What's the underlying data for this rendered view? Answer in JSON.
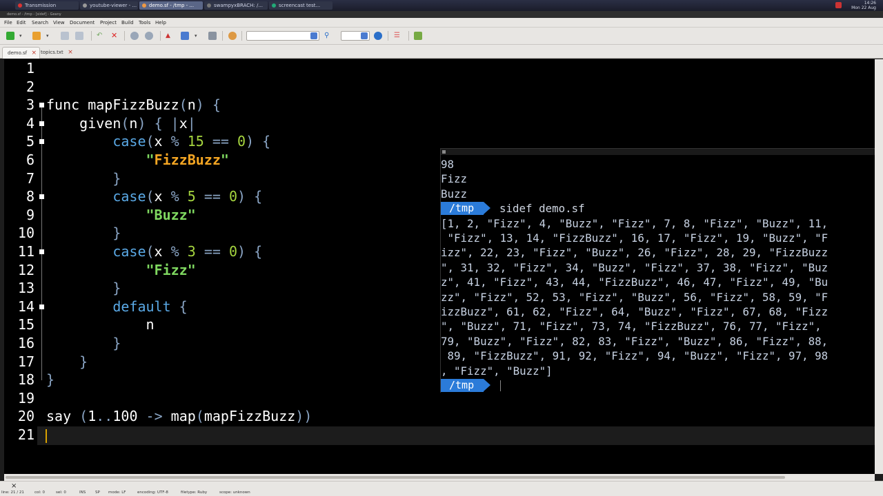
{
  "taskbar": {
    "tasks": [
      {
        "label": "Transmission",
        "color": "#d33"
      },
      {
        "label": "youtube-viewer - ...",
        "color": "#999"
      },
      {
        "label": "demo.sf - /tmp - ...",
        "color": "#e94"
      },
      {
        "label": "swampyxBRACH: /...",
        "color": "#777"
      },
      {
        "label": "screencast test...",
        "color": "#2a7"
      }
    ],
    "clock_time": "14:26",
    "clock_date": "Mon 22 Aug"
  },
  "window_title": "demo.sf - /tmp - [sidef] - Geany",
  "menu": [
    "File",
    "Edit",
    "Search",
    "View",
    "Document",
    "Project",
    "Build",
    "Tools",
    "Help"
  ],
  "tabs": [
    {
      "label": "demo.sf"
    },
    {
      "label": "topics.txt"
    }
  ],
  "editor": {
    "lines": [
      {
        "n": "1",
        "code": ""
      },
      {
        "n": "2",
        "code": ""
      },
      {
        "n": "3",
        "code": "func mapFizzBuzz(n) {"
      },
      {
        "n": "4",
        "code": "    given(n) { |x|"
      },
      {
        "n": "5",
        "code": "        case(x % 15 == 0) {"
      },
      {
        "n": "6",
        "code": "            \"FizzBuzz\""
      },
      {
        "n": "7",
        "code": "        }"
      },
      {
        "n": "8",
        "code": "        case(x % 5 == 0) {"
      },
      {
        "n": "9",
        "code": "            \"Buzz\""
      },
      {
        "n": "10",
        "code": "        }"
      },
      {
        "n": "11",
        "code": "        case(x % 3 == 0) {"
      },
      {
        "n": "12",
        "code": "            \"Fizz\""
      },
      {
        "n": "13",
        "code": "        }"
      },
      {
        "n": "14",
        "code": "        default {"
      },
      {
        "n": "15",
        "code": "            n"
      },
      {
        "n": "16",
        "code": "        }"
      },
      {
        "n": "17",
        "code": "    }"
      },
      {
        "n": "18",
        "code": "}"
      },
      {
        "n": "19",
        "code": ""
      },
      {
        "n": "20",
        "code": "say (1..100 -> map(mapFizzBuzz))"
      },
      {
        "n": "21",
        "code": ""
      }
    ]
  },
  "terminal": {
    "prev_lines": [
      "98",
      "Fizz",
      "Buzz"
    ],
    "prompt_dir": "/tmp",
    "command": "sidef demo.sf",
    "output": [
      "[1, 2, \"Fizz\", 4, \"Buzz\", \"Fizz\", 7, 8, \"Fizz\", \"Buzz\", 11,",
      " \"Fizz\", 13, 14, \"FizzBuzz\", 16, 17, \"Fizz\", 19, \"Buzz\", \"F",
      "izz\", 22, 23, \"Fizz\", \"Buzz\", 26, \"Fizz\", 28, 29, \"FizzBuzz",
      "\", 31, 32, \"Fizz\", 34, \"Buzz\", \"Fizz\", 37, 38, \"Fizz\", \"Buz",
      "z\", 41, \"Fizz\", 43, 44, \"FizzBuzz\", 46, 47, \"Fizz\", 49, \"Bu",
      "zz\", \"Fizz\", 52, 53, \"Fizz\", \"Buzz\", 56, \"Fizz\", 58, 59, \"F",
      "izzBuzz\", 61, 62, \"Fizz\", 64, \"Buzz\", \"Fizz\", 67, 68, \"Fizz",
      "\", \"Buzz\", 71, \"Fizz\", 73, 74, \"FizzBuzz\", 76, 77, \"Fizz\",",
      "79, \"Buzz\", \"Fizz\", 82, 83, \"Fizz\", \"Buzz\", 86, \"Fizz\", 88,",
      " 89, \"FizzBuzz\", 91, 92, \"Fizz\", 94, \"Buzz\", \"Fizz\", 97, 98",
      ", \"Fizz\", \"Buzz\"]"
    ]
  },
  "status": {
    "pos": "line: 21 / 21",
    "col": "col: 0",
    "sel": "sel: 0",
    "ins": "INS",
    "sp": "SP",
    "mode": "mode: LF",
    "encoding": "encoding: UTF-8",
    "filetype": "filetype: Ruby",
    "scope": "scope: unknown"
  }
}
